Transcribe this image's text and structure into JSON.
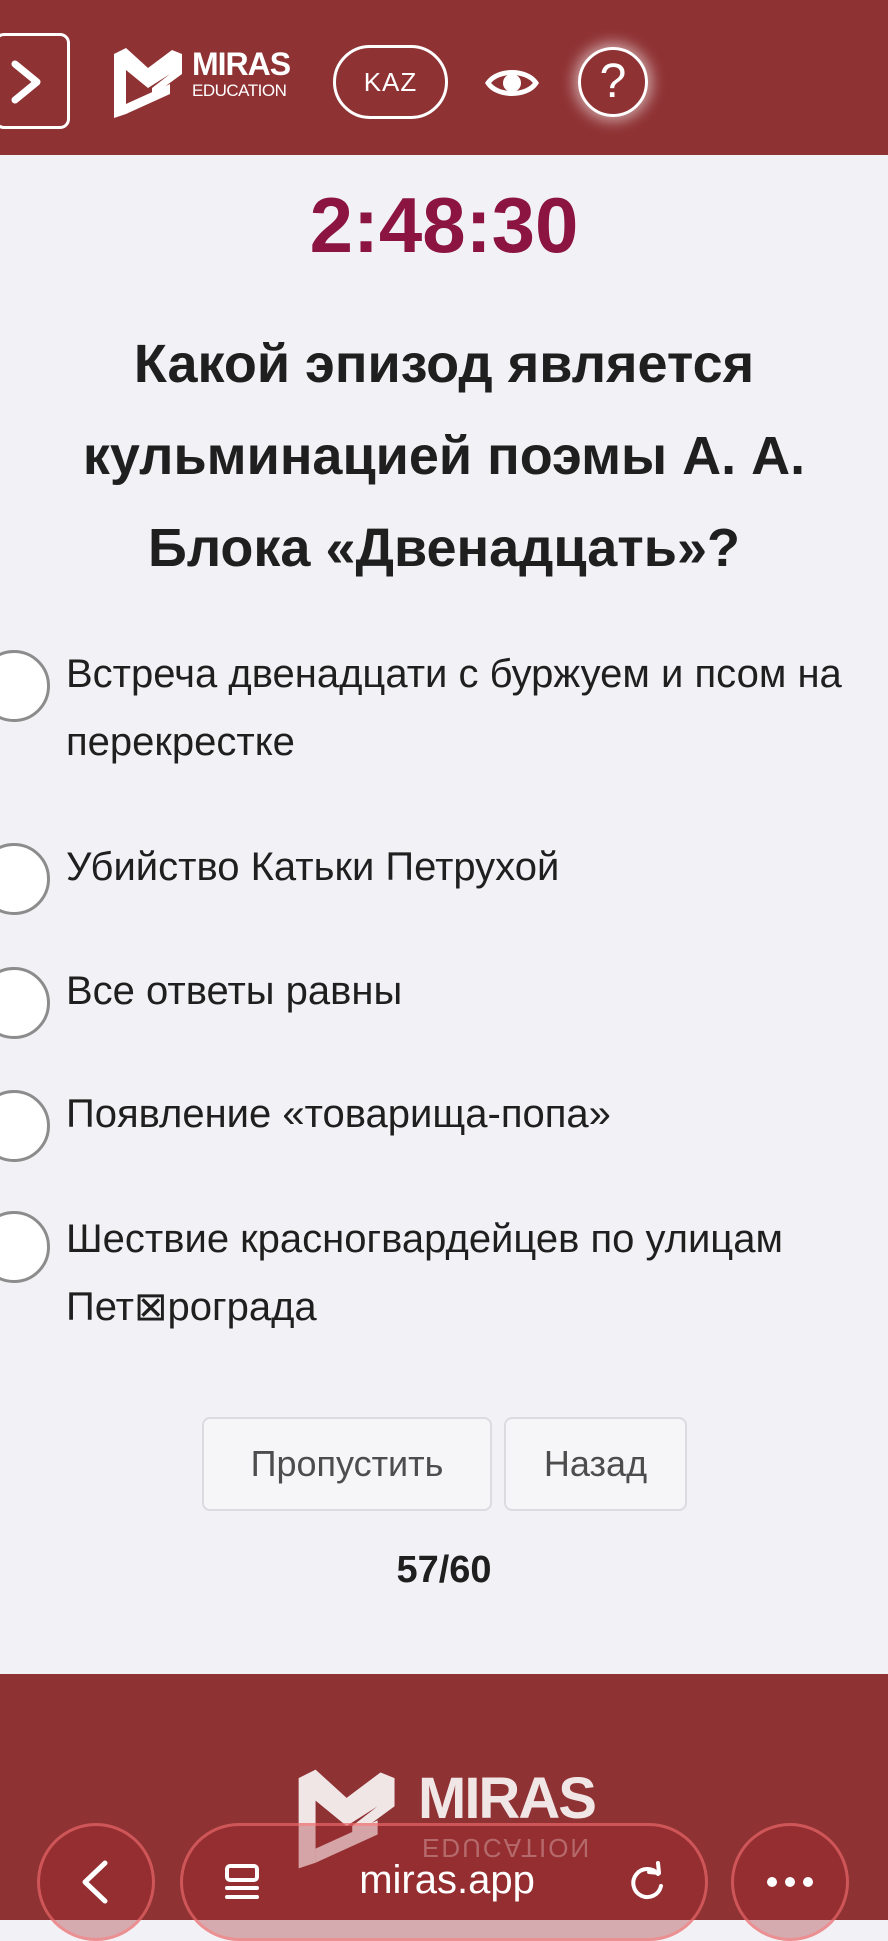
{
  "header": {
    "logo_word": "MIRAS",
    "logo_sub": "EDUCATION",
    "lang_label": "KAZ",
    "help_label": "?"
  },
  "quiz": {
    "timer": "2:48:30",
    "question": "Какой эпизод является кульминацией поэмы А. А. Блока «Двенадцать»?",
    "options": [
      {
        "text": "Встреча двенадцати с буржуем и псом на перекрестке",
        "selected": false
      },
      {
        "text": "Убийство Катьки Петрухой",
        "selected": false
      },
      {
        "text": "Все ответы равны",
        "selected": false
      },
      {
        "text": "Появление «товарища-попа»",
        "selected": false
      },
      {
        "text": "Шествие красногвардейцев по улицам Пет⊠рограда",
        "selected": false
      }
    ],
    "skip_label": "Пропустить",
    "back_label": "Назад",
    "progress": "57/60"
  },
  "footer": {
    "logo_word": "MIRAS",
    "logo_sub": "EDUCATION"
  },
  "browser": {
    "url": "miras.app"
  },
  "colors": {
    "brand": "#8f3234",
    "timer": "#8b1540",
    "background": "#f2f2f6"
  },
  "icons": [
    "chevron-right-icon",
    "eye-icon",
    "question-icon",
    "chevron-left-icon",
    "reader-icon",
    "reload-icon",
    "more-icon"
  ]
}
